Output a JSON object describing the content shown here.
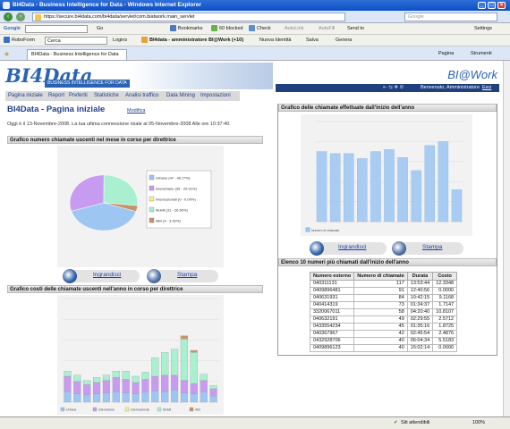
{
  "window": {
    "title": "BI4Data - Business Intelligence for Data - Windows Internet Explorer"
  },
  "address": {
    "url": "https://secure.bi4data.com/bi4data/servlet/com.biatwork.main_servlet",
    "search_placeholder": "Google"
  },
  "toolbar1": {
    "google_label": "Google",
    "go_label": "Go",
    "bookmarks_label": "Bookmarks",
    "blocked_label": "60 blocked",
    "check_label": "Check",
    "autolink_label": "AutoLink",
    "autofill_label": "AutoFill",
    "sendto_label": "Send to",
    "settings_label": "Settings"
  },
  "toolbar2": {
    "roboform_label": "RoboForm",
    "cerca_label": "Cerca",
    "logins_label": "Logins",
    "identity_label": "BI4data - amministratore BI@Work (+10)",
    "nuova_label": "Nuova Identità",
    "salva_label": "Salva",
    "genera_label": "Genera"
  },
  "tabs": {
    "active_tab": "BI4Data - Business Intelligence for Data",
    "pagina_label": "Pagina",
    "strumenti_label": "Strumenti"
  },
  "header": {
    "logo_text": "BI4Data",
    "banner_text": "BUSINESS INTELLIGENCE FOR DATA",
    "biwork": "BI@Work",
    "welcome": "Benvenuto, Amministratore",
    "esci": "Esci"
  },
  "menu": [
    "Pagina iniziale",
    "Report",
    "Preferiti",
    "Statistiche",
    "Analisi traffico",
    "Data Mining",
    "Impostazioni"
  ],
  "page": {
    "title": "BI4Data - Pagina iniziale",
    "modifica": "Modifica",
    "last_login": "Oggi è il 13-Novembre-2008. La tua ultima connessione risale al 05-Novembre-2008 Alle ore 10:37:40."
  },
  "sections": {
    "pie_title": "Grafico numero chiamate uscenti nel mese in corso per direttrice",
    "stack_title": "Grafico costi delle chiamate uscenti nell'anno in corso per direttrice",
    "bar_title": "Grafico delle chiamate effettuate dall'inizio dell'anno",
    "table_title": "Elenco 10 numeri più chiamati dall'inizio dell'anno"
  },
  "actions": {
    "ingrandisci": "Ingrandisci",
    "stampa": "Stampa"
  },
  "colors": {
    "urbane": "#9ec6f2",
    "interurbane": "#c79cf0",
    "internazionali": "#f6ee8c",
    "mobili": "#a8f0d0",
    "altri": "#c6946a"
  },
  "chart_data": [
    {
      "type": "pie",
      "title": "Grafico numero chiamate uscenti nel mese in corso per direttrice",
      "legend": [
        "Urbane (47 - 40.17%)",
        "Interurbane (35 - 29.91%)",
        "Internazionali (0 - 0.00%)",
        "Mobili (31 - 26.50%)",
        "Altri (4 - 3.42%)"
      ],
      "categories": [
        "Urbane",
        "Interurbane",
        "Internazionali",
        "Mobili",
        "Altri"
      ],
      "values": [
        47,
        35,
        0,
        31,
        4
      ]
    },
    {
      "type": "bar",
      "title": "Grafico delle chiamate effettuate dall'inizio dell'anno",
      "legend": [
        "Numero di chiamate"
      ],
      "values": [
        70,
        68,
        68,
        63,
        70,
        72,
        64,
        51,
        76,
        80,
        32
      ],
      "ylim": [
        0,
        100
      ]
    },
    {
      "type": "bar",
      "stacked": true,
      "title": "Grafico costi delle chiamate uscenti nell'anno in corso per direttrice",
      "legend": [
        "Urbane",
        "Interurbane",
        "Internazionali",
        "Mobili",
        "Altri"
      ],
      "series": [
        {
          "name": "Urbane",
          "values": [
            10,
            8,
            7,
            8,
            9,
            10,
            9,
            8,
            10,
            11,
            10,
            12,
            9,
            8,
            10,
            6
          ]
        },
        {
          "name": "Interurbane",
          "values": [
            15,
            12,
            10,
            11,
            12,
            14,
            13,
            11,
            12,
            14,
            16,
            14,
            12,
            10,
            11,
            7
          ]
        },
        {
          "name": "Internazionali",
          "values": [
            0,
            0,
            0,
            0,
            0,
            0,
            0,
            0,
            0,
            0,
            0,
            0,
            0,
            0,
            0,
            0
          ]
        },
        {
          "name": "Mobili",
          "values": [
            5,
            6,
            4,
            5,
            5,
            6,
            8,
            6,
            7,
            18,
            22,
            25,
            40,
            30,
            6,
            3
          ]
        },
        {
          "name": "Altri",
          "values": [
            0,
            0,
            0,
            0,
            0,
            0,
            0,
            0,
            0,
            0,
            0,
            0,
            3,
            2,
            0,
            0
          ]
        }
      ],
      "ylim": [
        0,
        100
      ]
    }
  ],
  "calls_table": {
    "headers": [
      "Numero esterno",
      "Numero di chiamate",
      "Durata",
      "Costo"
    ],
    "rows": [
      [
        "040311131",
        "117",
        "13:53:44",
        "12.3348"
      ],
      [
        "0409896481",
        "91",
        "12:40:56",
        "0.0000"
      ],
      [
        "040631931",
        "84",
        "10:42:15",
        "9.1168"
      ],
      [
        "040414319",
        "73",
        "01:34:37",
        "1.7147"
      ],
      [
        "3320067011",
        "58",
        "04:20:40",
        "10.8107"
      ],
      [
        "040632191",
        "49",
        "02:29:55",
        "2.5712"
      ],
      [
        "0433554234",
        "45",
        "01:35:16",
        "1.8725"
      ],
      [
        "040367967",
        "42",
        "02:45:54",
        "2.4876"
      ],
      [
        "0432928706",
        "40",
        "06:04:34",
        "5.5183"
      ],
      [
        "0409896123",
        "40",
        "15:02:14",
        "0.0000"
      ]
    ]
  },
  "status": {
    "text": "Siti attendibili",
    "zoom": "100%"
  }
}
